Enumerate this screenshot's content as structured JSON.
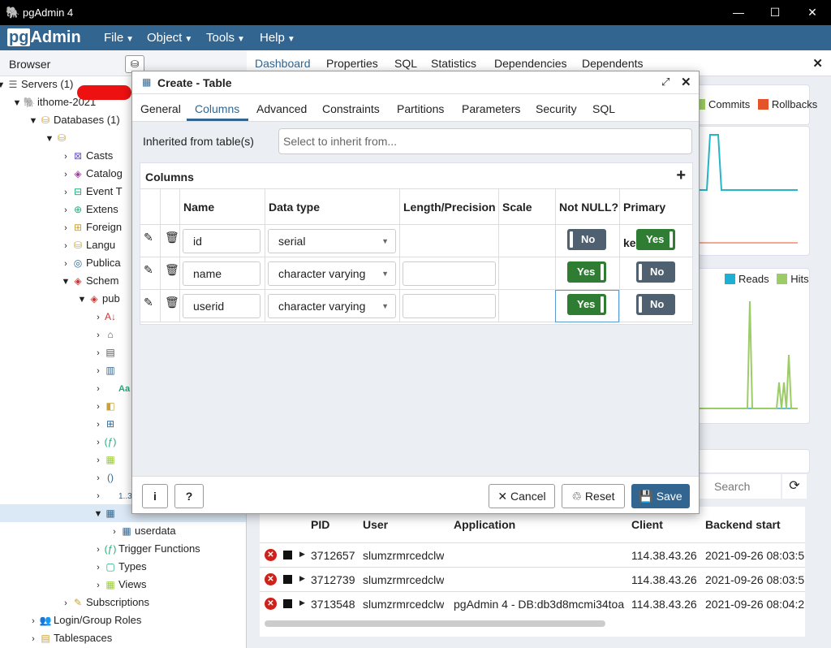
{
  "window": {
    "title": "pgAdmin 4",
    "controls": {
      "minimize": "—",
      "maximize": "☐",
      "close": "✕"
    }
  },
  "menubar": {
    "logo_pg": "pg",
    "logo_rest": "Admin",
    "items": [
      "File",
      "Object",
      "Tools",
      "Help"
    ]
  },
  "browser": {
    "label": "Browser",
    "tree": [
      {
        "label": "Servers (1)"
      },
      {
        "label": "ithome-2021"
      },
      {
        "label": "Databases (1)"
      },
      {
        "label": ""
      },
      {
        "label": "Casts"
      },
      {
        "label": "Catalog"
      },
      {
        "label": "Event T"
      },
      {
        "label": "Extens"
      },
      {
        "label": "Foreign"
      },
      {
        "label": "Langu"
      },
      {
        "label": "Publica"
      },
      {
        "label": "Schem"
      },
      {
        "label": "pub"
      },
      {
        "label": ""
      },
      {
        "label": ""
      },
      {
        "label": ""
      },
      {
        "label": ""
      },
      {
        "label": "Aa"
      },
      {
        "label": ""
      },
      {
        "label": ""
      },
      {
        "label": ""
      },
      {
        "label": ""
      },
      {
        "label": ""
      },
      {
        "label": "1..3"
      },
      {
        "label": ""
      },
      {
        "label": "userdata"
      },
      {
        "label": "Trigger Functions"
      },
      {
        "label": "Types"
      },
      {
        "label": "Views"
      },
      {
        "label": "Subscriptions"
      },
      {
        "label": "Login/Group Roles"
      },
      {
        "label": "Tablespaces"
      }
    ]
  },
  "tabs": [
    "Dashboard",
    "Properties",
    "SQL",
    "Statistics",
    "Dependencies",
    "Dependents"
  ],
  "dashboard": {
    "legend1": [
      {
        "name": "Commits",
        "color": "#2ab0d6"
      },
      {
        "name": "Rollbacks",
        "color": "#e4532a"
      }
    ],
    "legend2": [
      {
        "name": "Reads",
        "color": "#1eb0d4"
      },
      {
        "name": "Hits",
        "color": "#9ccc65"
      }
    ],
    "search_placeholder": "Search",
    "activity": {
      "headers": [
        "PID",
        "User",
        "Application",
        "Client",
        "Backend start"
      ],
      "rows": [
        {
          "pid": "3712657",
          "user": "slumzrmrcedclw",
          "app": "",
          "client": "114.38.43.26",
          "start": "2021-09-26 08:03:5"
        },
        {
          "pid": "3712739",
          "user": "slumzrmrcedclw",
          "app": "",
          "client": "114.38.43.26",
          "start": "2021-09-26 08:03:5"
        },
        {
          "pid": "3713548",
          "user": "slumzrmrcedclw",
          "app": "pgAdmin 4 - DB:db3d8mcmi34toa",
          "client": "114.38.43.26",
          "start": "2021-09-26 08:04:2"
        }
      ]
    }
  },
  "modal": {
    "title": "Create - Table",
    "tabs": [
      "General",
      "Columns",
      "Advanced",
      "Constraints",
      "Partitions",
      "Parameters",
      "Security",
      "SQL"
    ],
    "inherit_label": "Inherited from table(s)",
    "inherit_placeholder": "Select to inherit from...",
    "columns_label": "Columns",
    "headers": [
      "Name",
      "Data type",
      "Length/Precision",
      "Scale",
      "Not NULL?",
      "Primary key?"
    ],
    "rows": [
      {
        "name": "id",
        "type": "serial",
        "not_null": "No",
        "pk": "Yes"
      },
      {
        "name": "name",
        "type": "character varying",
        "not_null": "Yes",
        "pk": "No"
      },
      {
        "name": "userid",
        "type": "character varying",
        "not_null": "Yes",
        "pk": "No"
      }
    ],
    "buttons": {
      "info": "i",
      "help": "?",
      "cancel": "✕ Cancel",
      "reset": "♲ Reset",
      "save": "💾 Save"
    }
  }
}
